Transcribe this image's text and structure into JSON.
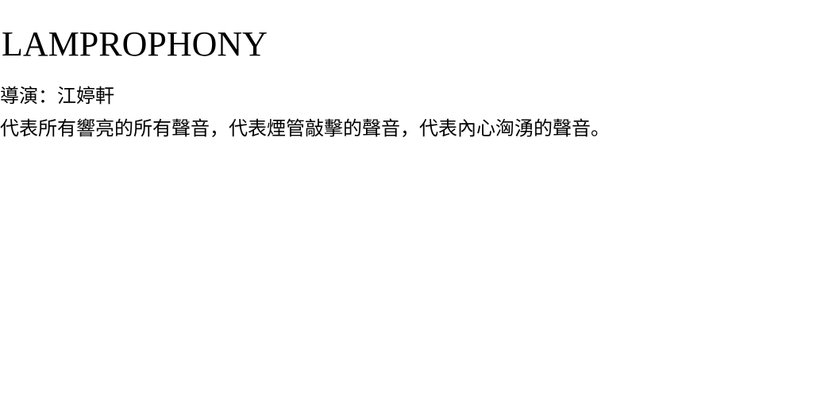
{
  "title": "LAMPROPHONY",
  "credit": "導演：江婷軒",
  "description": "代表所有響亮的所有聲音，代表煙管敲擊的聲音，代表內心洶湧的聲音。",
  "colors": {
    "background": "#ffffff",
    "text": "#000000"
  }
}
